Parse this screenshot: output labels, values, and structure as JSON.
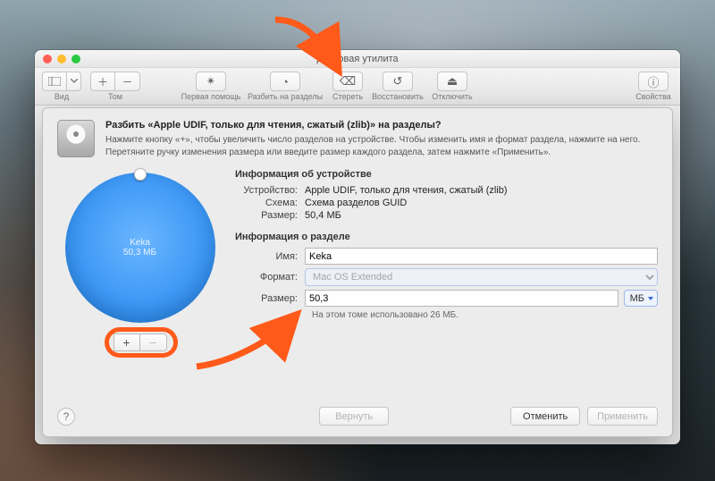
{
  "window": {
    "title": "Дисковая утилита"
  },
  "toolbar": {
    "view_label": "Вид",
    "volume_label": "Том",
    "first_aid": "Первая помощь",
    "partition": "Разбить на разделы",
    "erase": "Стереть",
    "restore": "Восстановить",
    "unmount": "Отключить",
    "info": "Свойства"
  },
  "sheet": {
    "heading": "Разбить «Apple UDIF, только для чтения, сжатый (zlib)» на разделы?",
    "sub": "Нажмите кнопку «+», чтобы увеличить число разделов на устройстве. Чтобы изменить имя и формат раздела, нажмите на него. Перетяните ручку изменения размера или введите размер каждого раздела, затем нажмите «Применить».",
    "pie_name": "Keka",
    "pie_size": "50,3 МБ",
    "device_section": "Информация об устройстве",
    "device_label": "Устройство:",
    "device_value": "Apple UDIF, только для чтения, сжатый (zlib)",
    "scheme_label": "Схема:",
    "scheme_value": "Схема разделов GUID",
    "size_label": "Размер:",
    "size_value": "50,4 МБ",
    "part_section": "Информация о разделе",
    "name_label": "Имя:",
    "name_value": "Keka",
    "format_label": "Формат:",
    "format_value": "Mac OS Extended",
    "psize_label": "Размер:",
    "psize_value": "50,3",
    "unit": "МБ",
    "used_note": "На этом томе использовано 26 МБ.",
    "help": "?",
    "revert": "Вернуть",
    "cancel": "Отменить",
    "apply": "Применить"
  }
}
